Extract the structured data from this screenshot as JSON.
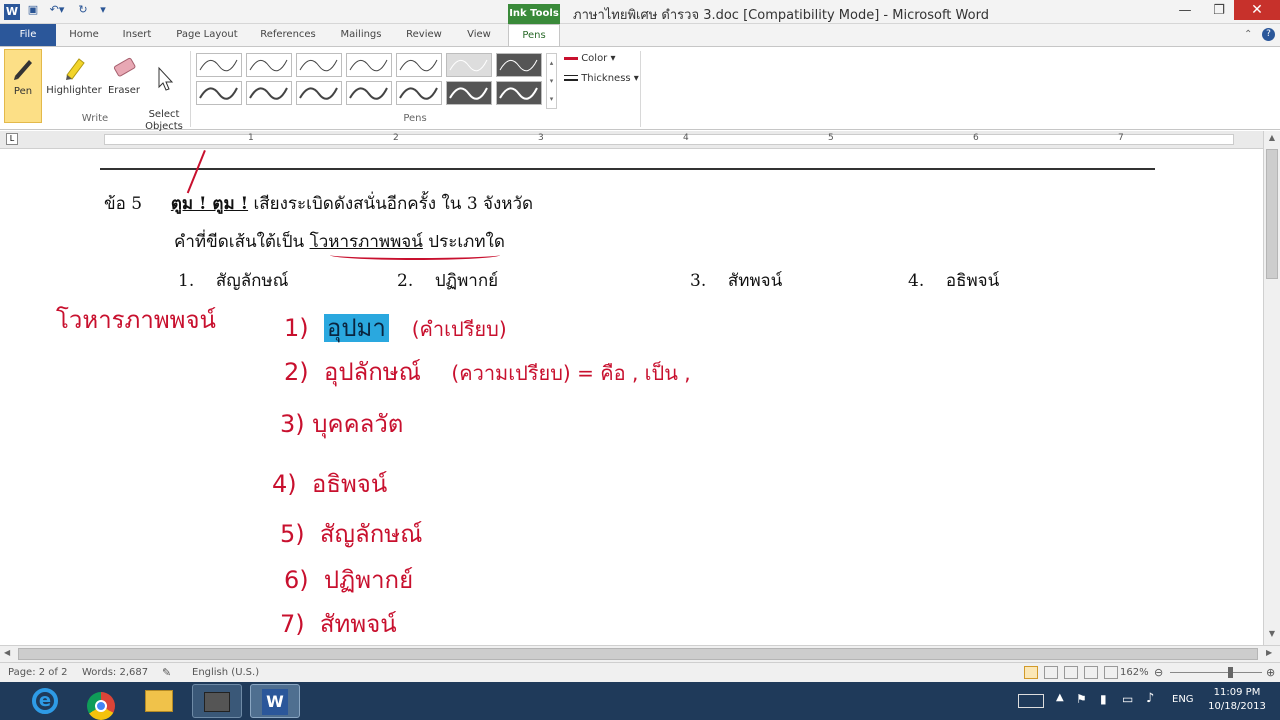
{
  "window": {
    "title": "ภาษาไทยพิเศษ ดำรวจ 3.doc [Compatibility Mode]  -  Microsoft Word",
    "contextual_tab": "Ink Tools",
    "app_icon": "W"
  },
  "tabs": [
    "File",
    "Home",
    "Insert",
    "Page Layout",
    "References",
    "Mailings",
    "Review",
    "View",
    "Pens"
  ],
  "ribbon": {
    "write_group": {
      "label": "Write",
      "buttons": [
        "Pen",
        "Highlighter",
        "Eraser",
        "Select\nObjects"
      ]
    },
    "pens_group": {
      "label": "Pens"
    },
    "color_label": "Color",
    "thickness_label": "Thickness"
  },
  "document": {
    "question": "ข้อ   5",
    "question_bold": "ตูม ! ตูม !",
    "question_rest": "  เสียงระเบิดดังสนั่นอีกครั้ง  ใน  3  จังหวัด",
    "prompt_prefix": "คำที่ขีดเส้นใต้เป็น",
    "prompt_underline": "โวหารภาพพจน์",
    "prompt_suffix": "ประเภทใด",
    "choices": [
      {
        "num": "1.",
        "text": "สัญลักษณ์"
      },
      {
        "num": "2.",
        "text": "ปฏิพากย์"
      },
      {
        "num": "3.",
        "text": "สัทพจน์"
      },
      {
        "num": "4.",
        "text": "อธิพจน์"
      }
    ]
  },
  "ink": {
    "heading": "โวหารภาพพจน์",
    "items": [
      {
        "num": "1)",
        "text": "อุปมา",
        "note": "(คำเปรียบ)"
      },
      {
        "num": "2)",
        "text": "อุปลักษณ์",
        "note": "(ความเปรียบ)  =  คือ ,  เป็น ,"
      },
      {
        "num": "3)",
        "text": "บุคคลวัต",
        "note": ""
      },
      {
        "num": "4)",
        "text": "อธิพจน์",
        "note": ""
      },
      {
        "num": "5)",
        "text": "สัญลักษณ์",
        "note": ""
      },
      {
        "num": "6)",
        "text": "ปฏิพากย์",
        "note": ""
      },
      {
        "num": "7)",
        "text": "สัทพจน์",
        "note": ""
      }
    ],
    "highlight_color": "#2aa8df",
    "ink_color": "#c8102e"
  },
  "ruler_numbers": [
    "1",
    "2",
    "3",
    "4",
    "5",
    "6",
    "7"
  ],
  "status": {
    "page": "Page: 2 of 2",
    "words": "Words: 2,687",
    "language": "English (U.S.)",
    "zoom": "162%"
  },
  "taskbar": {
    "lang": "ENG",
    "time": "11:09 PM",
    "date": "10/18/2013"
  }
}
